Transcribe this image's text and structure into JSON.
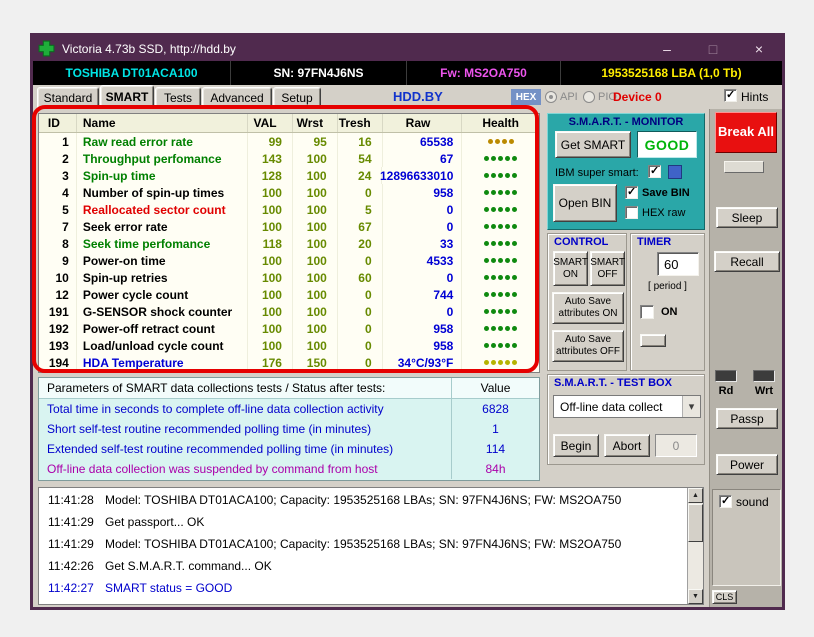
{
  "window": {
    "title": "Victoria 4.73b SSD, http://hdd.by",
    "minimize": "–",
    "maximize": "□",
    "close": "×"
  },
  "device_bar": {
    "model": "TOSHIBA DT01ACA100",
    "serial": "SN: 97FN4J6NS",
    "firmware": "Fw: MS2OA750",
    "capacity": "1953525168 LBA (1,0 Tb)"
  },
  "tab_bar": {
    "tabs": [
      {
        "label": "Standard",
        "active": false
      },
      {
        "label": "SMART",
        "active": true
      },
      {
        "label": "Tests",
        "active": false
      },
      {
        "label": "Advanced",
        "active": false
      },
      {
        "label": "Setup",
        "active": false
      }
    ],
    "site_link": "HDD.BY",
    "hex_label": "HEX",
    "api_label": "API",
    "pio_label": "PIO",
    "device_label": "Device 0",
    "hints_label": "Hints",
    "hints_checked": true
  },
  "smart_table": {
    "headers": [
      "ID",
      "Name",
      "VAL",
      "Wrst",
      "Tresh",
      "Raw",
      "Health"
    ],
    "value_color": "#678a00",
    "raw_color": "#0000d4",
    "rows": [
      {
        "id": "1",
        "name": "Raw read error rate",
        "val": "99",
        "wrst": "95",
        "tresh": "16",
        "raw": "65538",
        "name_color": "#008000",
        "health": {
          "count": 4,
          "color": "#bb8a00"
        }
      },
      {
        "id": "2",
        "name": "Throughput perfomance",
        "val": "143",
        "wrst": "100",
        "tresh": "54",
        "raw": "67",
        "name_color": "#008000",
        "health": {
          "count": 5,
          "color": "#0f8a0f"
        }
      },
      {
        "id": "3",
        "name": "Spin-up time",
        "val": "128",
        "wrst": "100",
        "tresh": "24",
        "raw": "12896633010",
        "name_color": "#008000",
        "health": {
          "count": 5,
          "color": "#0f8a0f"
        }
      },
      {
        "id": "4",
        "name": "Number of spin-up times",
        "val": "100",
        "wrst": "100",
        "tresh": "0",
        "raw": "958",
        "name_color": "#000000",
        "health": {
          "count": 5,
          "color": "#0f8a0f"
        }
      },
      {
        "id": "5",
        "name": "Reallocated sector count",
        "val": "100",
        "wrst": "100",
        "tresh": "5",
        "raw": "0",
        "name_color": "#e00000",
        "health": {
          "count": 5,
          "color": "#0f8a0f"
        }
      },
      {
        "id": "7",
        "name": "Seek error rate",
        "val": "100",
        "wrst": "100",
        "tresh": "67",
        "raw": "0",
        "name_color": "#000000",
        "health": {
          "count": 5,
          "color": "#0f8a0f"
        }
      },
      {
        "id": "8",
        "name": "Seek time perfomance",
        "val": "118",
        "wrst": "100",
        "tresh": "20",
        "raw": "33",
        "name_color": "#008000",
        "health": {
          "count": 5,
          "color": "#0f8a0f"
        }
      },
      {
        "id": "9",
        "name": "Power-on time",
        "val": "100",
        "wrst": "100",
        "tresh": "0",
        "raw": "4533",
        "name_color": "#000000",
        "health": {
          "count": 5,
          "color": "#0f8a0f"
        }
      },
      {
        "id": "10",
        "name": "Spin-up retries",
        "val": "100",
        "wrst": "100",
        "tresh": "60",
        "raw": "0",
        "name_color": "#000000",
        "health": {
          "count": 5,
          "color": "#0f8a0f"
        }
      },
      {
        "id": "12",
        "name": "Power cycle count",
        "val": "100",
        "wrst": "100",
        "tresh": "0",
        "raw": "744",
        "name_color": "#000000",
        "health": {
          "count": 5,
          "color": "#0f8a0f"
        }
      },
      {
        "id": "191",
        "name": "G-SENSOR shock counter",
        "val": "100",
        "wrst": "100",
        "tresh": "0",
        "raw": "0",
        "name_color": "#000000",
        "health": {
          "count": 5,
          "color": "#0f8a0f"
        }
      },
      {
        "id": "192",
        "name": "Power-off retract count",
        "val": "100",
        "wrst": "100",
        "tresh": "0",
        "raw": "958",
        "name_color": "#000000",
        "health": {
          "count": 5,
          "color": "#0f8a0f"
        }
      },
      {
        "id": "193",
        "name": "Load/unload cycle count",
        "val": "100",
        "wrst": "100",
        "tresh": "0",
        "raw": "958",
        "name_color": "#000000",
        "health": {
          "count": 5,
          "color": "#0f8a0f"
        }
      },
      {
        "id": "194",
        "name": "HDA Temperature",
        "val": "176",
        "wrst": "150",
        "tresh": "0",
        "raw": "34°C/93°F",
        "name_color": "#0000d4",
        "health": {
          "count": 5,
          "color": "#b5b300"
        }
      }
    ]
  },
  "monitor": {
    "title": "S.M.A.R.T. - MONITOR",
    "get_smart_button": "Get SMART",
    "status": "GOOD",
    "status_color": "#00b40a",
    "ibm_label": "IBM super smart:",
    "ibm_checked": true,
    "open_bin_button": "Open BIN",
    "save_bin_label": "Save BIN",
    "save_bin_checked": true,
    "hex_raw_label": "HEX raw",
    "hex_raw_checked": false
  },
  "control": {
    "title": "CONTROL",
    "smart_on": "SMART ON",
    "smart_off": "SMART OFF",
    "autosave_on": "Auto Save attributes ON",
    "autosave_off": "Auto Save attributes OFF"
  },
  "timer": {
    "title": "TIMER",
    "value": "60",
    "period_label": "[ period ]",
    "on_label": "ON",
    "on_checked": false
  },
  "test_box": {
    "title": "S.M.A.R.T. - TEST BOX",
    "dropdown_value": "Off-line data collect",
    "begin_button": "Begin",
    "abort_button": "Abort",
    "counter": "0"
  },
  "parameters": {
    "header_left": "Parameters of SMART data collections tests / Status after tests:",
    "header_right": "Value",
    "rows": [
      {
        "text": "Total time in seconds to complete off-line data collection activity",
        "value": "6828",
        "color": "#0000cc"
      },
      {
        "text": "Short self-test routine recommended polling time (in minutes)",
        "value": "1",
        "color": "#0000cc"
      },
      {
        "text": "Extended self-test routine recommended polling time (in minutes)",
        "value": "114",
        "color": "#0000cc"
      },
      {
        "text": "Off-line data collection was suspended by command from host",
        "value": "84h",
        "color": "#aa00aa"
      }
    ]
  },
  "log": {
    "entries": [
      {
        "time": "11:41:28",
        "message": "Model: TOSHIBA DT01ACA100; Capacity: 1953525168 LBAs; SN: 97FN4J6NS; FW: MS2OA750",
        "color": "#000000"
      },
      {
        "time": "11:41:29",
        "message": "Get passport... OK",
        "color": "#000000"
      },
      {
        "time": "11:41:29",
        "message": "Model: TOSHIBA DT01ACA100; Capacity: 1953525168 LBAs; SN: 97FN4J6NS; FW: MS2OA750",
        "color": "#000000"
      },
      {
        "time": "11:42:26",
        "message": "Get S.M.A.R.T. command... OK",
        "color": "#000000"
      },
      {
        "time": "11:42:27",
        "message": "SMART status = GOOD",
        "color": "#0000cc"
      }
    ]
  },
  "sidebar": {
    "break_all": "Break All",
    "sleep": "Sleep",
    "recall": "Recall",
    "rd_label": "Rd",
    "wrt_label": "Wrt",
    "passp": "Passp",
    "power": "Power",
    "sound_label": "sound",
    "sound_checked": true,
    "cls_button": "CLS"
  },
  "colors": {
    "title_bar": "#502a4e",
    "annotation_red": "#e60000",
    "monitor_teal": "#2aa7a8",
    "good_green": "#00b40a"
  }
}
